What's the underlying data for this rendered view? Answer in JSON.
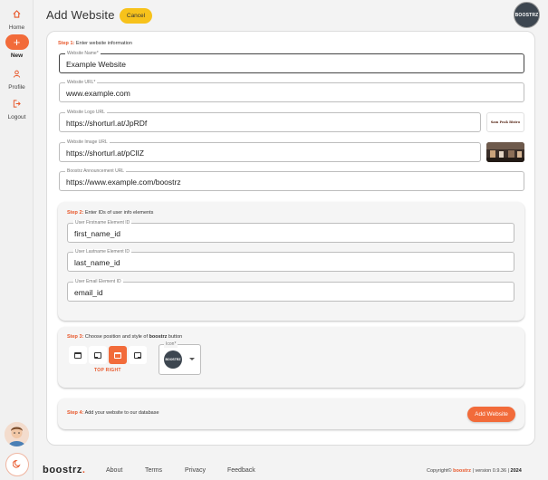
{
  "sidebar": {
    "items": [
      {
        "label": "Home",
        "icon": "home-icon"
      },
      {
        "label": "New",
        "icon": "plus-icon"
      },
      {
        "label": "Profile",
        "icon": "user-icon"
      },
      {
        "label": "Logout",
        "icon": "logout-icon"
      }
    ],
    "theme_icon": "moon-icon"
  },
  "header": {
    "title": "Add Website",
    "cancel_label": "Cancel",
    "logo_text": "BOOSTRZ"
  },
  "step1": {
    "num": "Step 1:",
    "text": " Enter website information",
    "fields": [
      {
        "label": "Website Name*",
        "value": "Example Website"
      },
      {
        "label": "Website URL*",
        "value": "www.example.com"
      },
      {
        "label": "Website Logo URL",
        "value": "https://shorturl.at/JpRDf"
      },
      {
        "label": "Website Image URL",
        "value": "https://shorturl.at/pClIZ"
      },
      {
        "label": "Boostrz Announcement URL",
        "value": "https://www.example.com/boostrz"
      }
    ],
    "logo_thumb_text": "Sam Peak Bistro"
  },
  "step2": {
    "num": "Step 2:",
    "text": " Enter IDs of user info elements",
    "fields": [
      {
        "label": "User Firstname Element ID",
        "value": "first_name_id"
      },
      {
        "label": "User Lastname Element ID",
        "value": "last_name_id"
      },
      {
        "label": "User Email Element ID",
        "value": "email_id"
      }
    ]
  },
  "step3": {
    "num": "Step 3:",
    "text_before": " Choose position and style of ",
    "brand": "boostrz",
    "text_after": " button",
    "selected_position": "TOP RIGHT",
    "icon_label": "Icon*",
    "icon_text": "BOOSTRZ"
  },
  "step4": {
    "num": "Step 4:",
    "text": " Add your website to our database",
    "button": "Add Website"
  },
  "footer": {
    "logo": "boostrz",
    "logo_dot": ".",
    "links": [
      "About",
      "Terms",
      "Privacy",
      "Feedback"
    ],
    "copyright_pre": "Copyright© ",
    "copyright_brand": "boostrz",
    "copyright_version": " | version 0.9.36 | ",
    "copyright_year": "2024"
  },
  "colors": {
    "accent": "#f26b3a",
    "cancel": "#f7c21b",
    "dark": "#3d4650"
  }
}
